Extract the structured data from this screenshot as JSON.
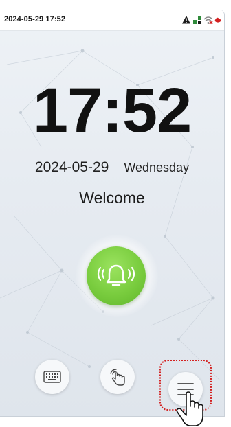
{
  "status_bar": {
    "datetime": "2024-05-29 17:52",
    "icons": [
      "warning-icon",
      "network-icon",
      "wifi-icon",
      "cloud-icon"
    ]
  },
  "main": {
    "clock": "17:52",
    "date": "2024-05-29",
    "weekday": "Wednesday",
    "welcome": "Welcome"
  },
  "actions": {
    "doorbell": {
      "icon": "doorbell-icon"
    },
    "bottom_buttons": [
      {
        "icon": "keyboard-icon"
      },
      {
        "icon": "touch-gesture-icon"
      },
      {
        "icon": "hamburger-menu-icon"
      }
    ]
  },
  "annotation": {
    "highlight_color": "#d32020",
    "pointer": "hand-pointer-icon"
  },
  "colors": {
    "accent_green": "#79cc3e",
    "background": "#e6ebf1"
  }
}
